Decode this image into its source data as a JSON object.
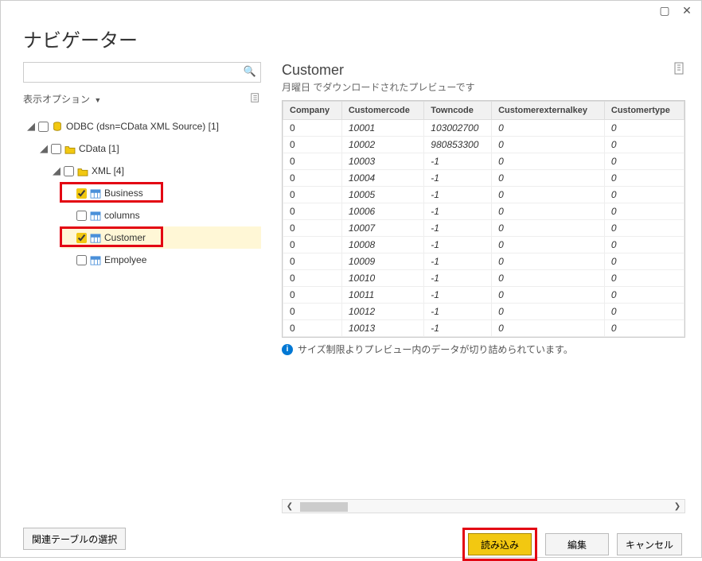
{
  "titlebar": {
    "restore": "▢",
    "close": "✕"
  },
  "header": {
    "title": "ナビゲーター"
  },
  "left": {
    "search_placeholder": "",
    "display_options": "表示オプション",
    "tree": {
      "root": "ODBC (dsn=CData XML Source) [1]",
      "lvl1": "CData [1]",
      "lvl2": "XML [4]",
      "items": [
        "Business",
        "columns",
        "Customer",
        "Empolyee"
      ]
    }
  },
  "right": {
    "title": "Customer",
    "subtitle": "月曜日 でダウンロードされたプレビューです",
    "columns": [
      "Company",
      "Customercode",
      "Towncode",
      "Customerexternalkey",
      "Customertype"
    ],
    "rows": [
      [
        "0",
        "10001",
        "103002700",
        "0",
        "0"
      ],
      [
        "0",
        "10002",
        "980853300",
        "0",
        "0"
      ],
      [
        "0",
        "10003",
        "-1",
        "0",
        "0"
      ],
      [
        "0",
        "10004",
        "-1",
        "0",
        "0"
      ],
      [
        "0",
        "10005",
        "-1",
        "0",
        "0"
      ],
      [
        "0",
        "10006",
        "-1",
        "0",
        "0"
      ],
      [
        "0",
        "10007",
        "-1",
        "0",
        "0"
      ],
      [
        "0",
        "10008",
        "-1",
        "0",
        "0"
      ],
      [
        "0",
        "10009",
        "-1",
        "0",
        "0"
      ],
      [
        "0",
        "10010",
        "-1",
        "0",
        "0"
      ],
      [
        "0",
        "10011",
        "-1",
        "0",
        "0"
      ],
      [
        "0",
        "10012",
        "-1",
        "0",
        "0"
      ],
      [
        "0",
        "10013",
        "-1",
        "0",
        "0"
      ]
    ],
    "info": "サイズ制限よりプレビュー内のデータが切り詰められています。"
  },
  "footer": {
    "related": "関連テーブルの選択",
    "load": "読み込み",
    "edit": "編集",
    "cancel": "キャンセル"
  }
}
